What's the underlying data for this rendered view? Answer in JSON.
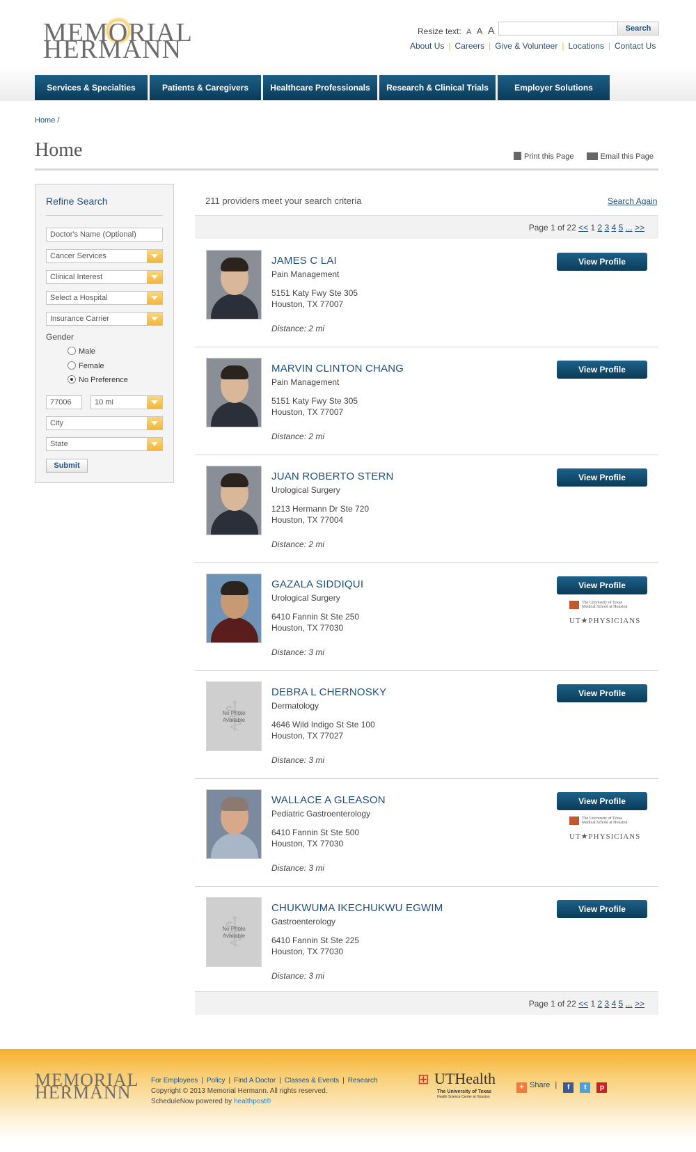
{
  "header": {
    "logo_line1": "MEMORIAL",
    "logo_line2": "HERMANN",
    "resize_label": "Resize text:",
    "resize_options": [
      "A",
      "A",
      "A"
    ],
    "search_button": "Search",
    "search_value": "",
    "top_links": [
      "About Us",
      "Careers",
      "Give & Volunteer",
      "Locations",
      "Contact Us"
    ]
  },
  "nav": [
    "Services & Specialties",
    "Patients & Caregivers",
    "Healthcare Professionals",
    "Research & Clinical Trials",
    "Employer Solutions"
  ],
  "breadcrumb": {
    "home": "Home",
    "separator": "/"
  },
  "page": {
    "title": "Home",
    "print_label": "Print this Page",
    "email_label": "Email this Page"
  },
  "sidebar": {
    "title": "Refine Search",
    "doctor_name_placeholder": "Doctor's Name (Optional)",
    "service": "Cancer Services",
    "clinical_interest": "Clinical Interest",
    "hospital": "Select a Hospital",
    "insurance": "Insurance Carrier",
    "gender_label": "Gender",
    "gender_options": [
      "Male",
      "Female",
      "No Preference"
    ],
    "gender_selected": "No Preference",
    "zip": "77006",
    "radius": "10 mi",
    "city": "City",
    "state": "State",
    "submit": "Submit"
  },
  "results": {
    "criteria_text": "211 providers meet your search criteria",
    "search_again": "Search Again",
    "pager": {
      "label": "Page 1 of 22",
      "prev": "<<",
      "current": "1",
      "pages": [
        "2",
        "3",
        "4",
        "5"
      ],
      "ellipsis": "...",
      "next": ">>"
    },
    "view_profile_label": "View Profile",
    "no_photo_line1": "No Photo",
    "no_photo_line2": "Available",
    "ut_line1": "The University of Texas",
    "ut_line2": "Medical School at Houston",
    "ut_line3": "UT★PHYSICIANS",
    "providers": [
      {
        "name": "JAMES C LAI",
        "specialty": "Pain Management",
        "address1": "5151 Katy Fwy Ste 305",
        "address2": "Houston, TX 77007",
        "distance": "Distance: 2 mi"
      },
      {
        "name": "MARVIN CLINTON CHANG",
        "specialty": "Pain Management",
        "address1": "5151 Katy Fwy Ste 305",
        "address2": "Houston, TX 77007",
        "distance": "Distance: 2 mi"
      },
      {
        "name": "JUAN ROBERTO STERN",
        "specialty": "Urological Surgery",
        "address1": "1213 Hermann Dr Ste 720",
        "address2": "Houston, TX 77004",
        "distance": "Distance: 2 mi"
      },
      {
        "name": "GAZALA SIDDIQUI",
        "specialty": "Urological Surgery",
        "address1": "6410 Fannin St Ste 250",
        "address2": "Houston, TX 77030",
        "distance": "Distance: 3 mi"
      },
      {
        "name": "DEBRA L CHERNOSKY",
        "specialty": "Dermatology",
        "address1": "4646 Wild Indigo St Ste 100",
        "address2": "Houston, TX 77027",
        "distance": "Distance: 3 mi"
      },
      {
        "name": "WALLACE A GLEASON",
        "specialty": "Pediatric Gastroenterology",
        "address1": "6410 Fannin St Ste 500",
        "address2": "Houston, TX 77030",
        "distance": "Distance: 3 mi"
      },
      {
        "name": "CHUKWUMA IKECHUKWU EGWIM",
        "specialty": "Gastroenterology",
        "address1": "6410 Fannin St Ste 225",
        "address2": "Houston, TX 77030",
        "distance": "Distance: 3 mi"
      }
    ]
  },
  "footer": {
    "logo_line1": "MEMORIAL",
    "logo_line2": "HERMANN",
    "links": [
      "For Employees",
      "Policy",
      "Find A Doctor",
      "Classes & Events",
      "Research"
    ],
    "copyright": "Copyright © 2013 Memorial Hermann. All rights reserved.",
    "schedule_text": "ScheduleNow powered by",
    "schedule_brand": "healthpost®",
    "uthealth_name": "UTHealth",
    "uthealth_sub1": "The University of Texas",
    "uthealth_sub2": "Health Science Center at Houston",
    "share_label": "Share"
  }
}
